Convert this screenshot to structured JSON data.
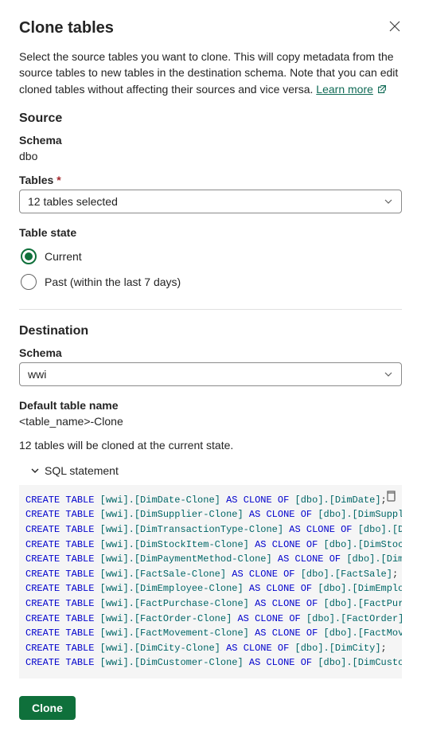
{
  "title": "Clone tables",
  "description_part1": "Select the source tables you want to clone. This will copy metadata from the source tables to new tables in the destination schema. Note that you can edit cloned tables without affecting their sources and vice versa. ",
  "learn_more": "Learn more",
  "source": {
    "heading": "Source",
    "schema_label": "Schema",
    "schema_value": "dbo",
    "tables_label": "Tables",
    "tables_selected": "12 tables selected",
    "table_state_label": "Table state",
    "radio_current": "Current",
    "radio_past": "Past (within the last 7 days)"
  },
  "destination": {
    "heading": "Destination",
    "schema_label": "Schema",
    "schema_value": "wwi",
    "default_name_label": "Default table name",
    "default_name_value": "<table_name>-Clone"
  },
  "status": "12 tables will be cloned at the current state.",
  "sql_heading": "SQL statement",
  "sql_rows": [
    {
      "dest": "[wwi].[DimDate-Clone]",
      "src": "[dbo].[DimDate]",
      "trail": ";"
    },
    {
      "dest": "[wwi].[DimSupplier-Clone]",
      "src": "[dbo].[DimSupplier]",
      "trail": ";"
    },
    {
      "dest": "[wwi].[DimTransactionType-Clone]",
      "src": "[dbo].[DimTra",
      "trail": ""
    },
    {
      "dest": "[wwi].[DimStockItem-Clone]",
      "src": "[dbo].[DimStockItem",
      "trail": ""
    },
    {
      "dest": "[wwi].[DimPaymentMethod-Clone]",
      "src": "[dbo].[DimPayme",
      "trail": ""
    },
    {
      "dest": "[wwi].[FactSale-Clone]",
      "src": "[dbo].[FactSale]",
      "trail": ";"
    },
    {
      "dest": "[wwi].[DimEmployee-Clone]",
      "src": "[dbo].[DimEmployee]",
      "trail": ";"
    },
    {
      "dest": "[wwi].[FactPurchase-Clone]",
      "src": "[dbo].[FactPurchase",
      "trail": ""
    },
    {
      "dest": "[wwi].[FactOrder-Clone]",
      "src": "[dbo].[FactOrder]",
      "trail": ";"
    },
    {
      "dest": "[wwi].[FactMovement-Clone]",
      "src": "[dbo].[FactMovement",
      "trail": ""
    },
    {
      "dest": "[wwi].[DimCity-Clone]",
      "src": "[dbo].[DimCity]",
      "trail": ";"
    },
    {
      "dest": "[wwi].[DimCustomer-Clone]",
      "src": "[dbo].[DimCustomer]",
      "trail": ";"
    }
  ],
  "sql_kw_create": "CREATE",
  "sql_kw_table": "TABLE",
  "sql_kw_as": "AS",
  "sql_kw_clone": "CLONE",
  "sql_kw_of": "OF",
  "clone_button": "Clone"
}
